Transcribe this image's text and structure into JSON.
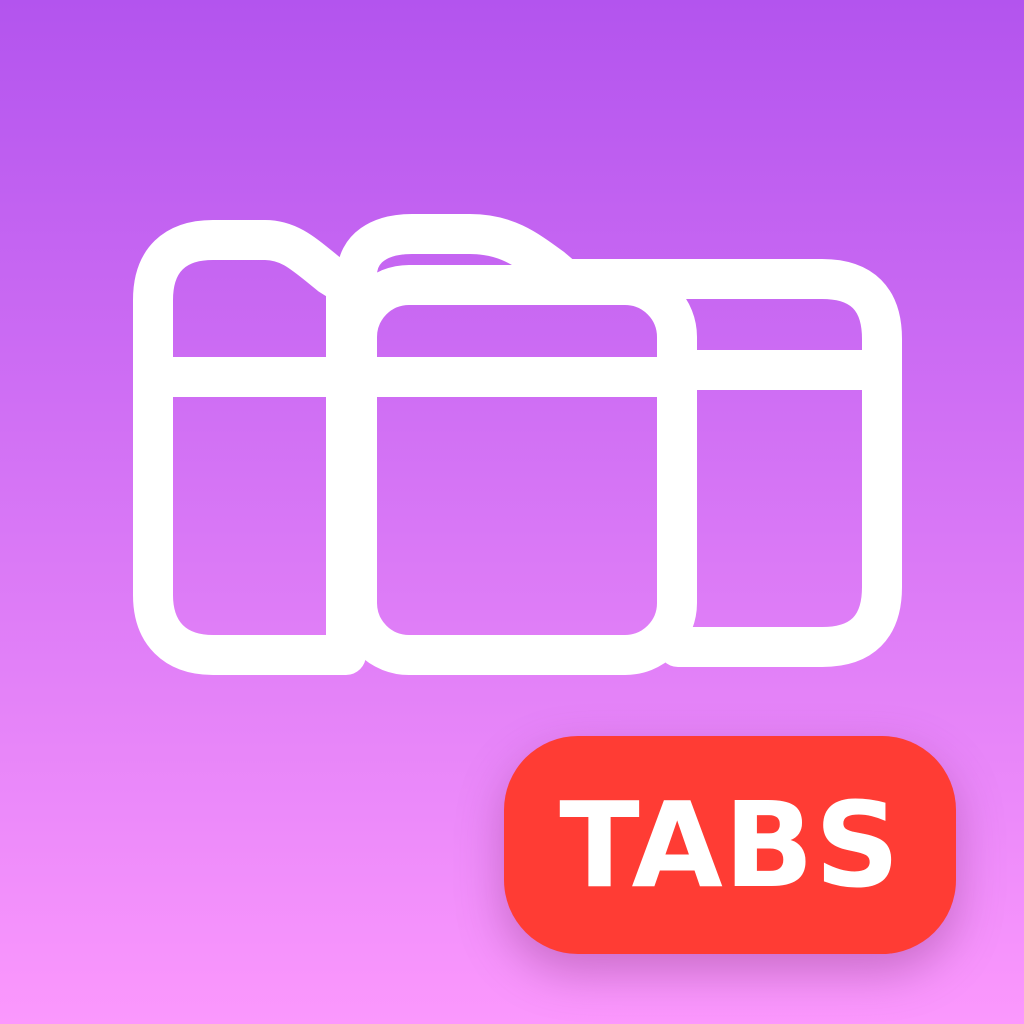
{
  "app_icon": {
    "background": {
      "gradient_top": "#b354ee",
      "gradient_bottom": "#fb98fd"
    },
    "folders": {
      "icon": "folder-stack-icon",
      "color": "#ffffff"
    },
    "badge": {
      "label": "TABS",
      "color": "#ff3c34",
      "text_color": "#ffffff"
    }
  }
}
